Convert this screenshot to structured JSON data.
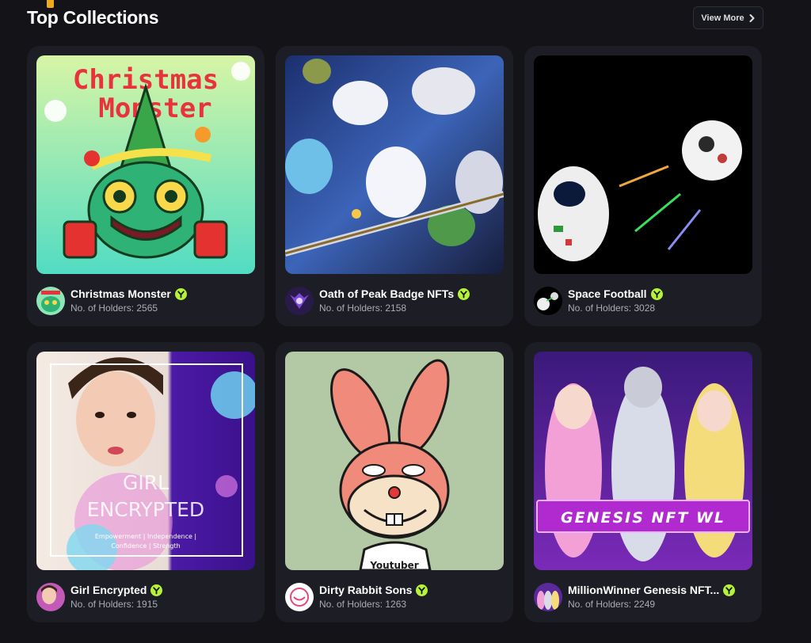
{
  "section": {
    "title": "Top Collections",
    "view_more_label": "View More"
  },
  "colors": {
    "background": "#131318",
    "card": "#1d1e25",
    "verified_badge": "#b5f23a",
    "muted_text": "#a9abb6",
    "accent": "#f0a81c"
  },
  "icons": {
    "verified": "verified-badge-icon",
    "view_more": "chevron-right-icon"
  },
  "collections": [
    {
      "name": "Christmas Monster",
      "holders_label": "No. of Holders: 2565",
      "image_text": [
        "Christmas",
        "Monster"
      ]
    },
    {
      "name": "Oath of Peak Badge NFTs",
      "holders_label": "No. of Holders: 2158"
    },
    {
      "name": "Space Football",
      "holders_label": "No. of Holders: 3028"
    },
    {
      "name": "Girl Encrypted",
      "holders_label": "No. of Holders: 1915",
      "image_text": [
        "GIRL",
        "ENCRYPTED",
        "Empowerment | Independence |",
        "Confidence | Strength"
      ]
    },
    {
      "name": "Dirty Rabbit Sons",
      "holders_label": "No. of Holders: 1263",
      "image_text": [
        "Youtuber"
      ]
    },
    {
      "name": "MillionWinner Genesis NFT...",
      "holders_label": "No. of Holders: 2249",
      "image_text": [
        "GENESIS NFT WL"
      ]
    }
  ]
}
